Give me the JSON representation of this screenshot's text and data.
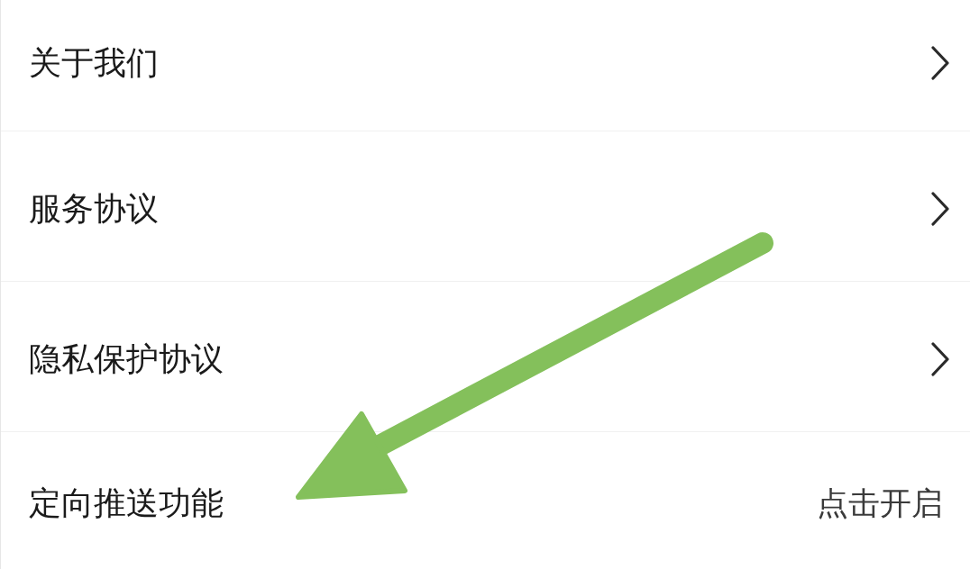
{
  "menu": [
    {
      "kind": "link",
      "label": "关于我们"
    },
    {
      "kind": "link",
      "label": "服务协议"
    },
    {
      "kind": "link",
      "label": "隐私保护协议"
    },
    {
      "kind": "action",
      "label": "定向推送功能",
      "value": "点击开启"
    }
  ]
}
